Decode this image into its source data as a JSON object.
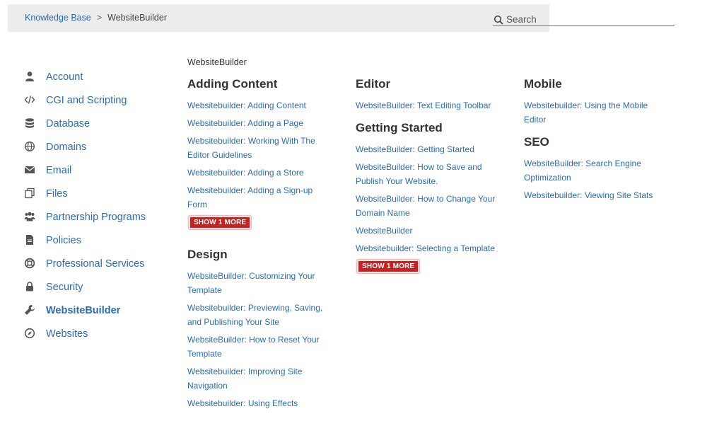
{
  "breadcrumb": {
    "root": "Knowledge Base",
    "separator": ">",
    "current": "WebsiteBuilder"
  },
  "search": {
    "placeholder": "Search",
    "value": ""
  },
  "page_label": "WebsiteBuilder",
  "sidebar": {
    "items": [
      {
        "label": "Account",
        "icon": "user-icon"
      },
      {
        "label": "CGI and Scripting",
        "icon": "code-icon"
      },
      {
        "label": "Database",
        "icon": "database-icon"
      },
      {
        "label": "Domains",
        "icon": "globe-icon"
      },
      {
        "label": "Email",
        "icon": "envelope-icon"
      },
      {
        "label": "Files",
        "icon": "files-icon"
      },
      {
        "label": "Partnership Programs",
        "icon": "users-icon"
      },
      {
        "label": "Policies",
        "icon": "document-icon"
      },
      {
        "label": "Professional Services",
        "icon": "lifebuoy-icon"
      },
      {
        "label": "Security",
        "icon": "lock-icon"
      },
      {
        "label": "WebsiteBuilder",
        "icon": "wrench-icon",
        "active": true
      },
      {
        "label": "Websites",
        "icon": "compass-icon"
      }
    ]
  },
  "columns": [
    [
      {
        "title": "Adding Content",
        "articles": [
          "Websitebuilder: Adding Content",
          "Websitebuilder: Adding a Page",
          "Websitebuilder: Working With The Editor Guidelines",
          "Websitebuilder: Adding a Store",
          "Websitebuilder: Adding a Sign-up Form"
        ],
        "show_more": "SHOW 1 MORE"
      },
      {
        "title": "Design",
        "articles": [
          "WebsiteBuilder: Customizing Your Template",
          "Websitebuilder: Previewing, Saving, and Publishing Your Site",
          "WebsiteBuilder: How to Reset Your Template",
          "Websitebuilder: Improving Site Navigation",
          "Websitebuilder: Using Effects"
        ],
        "show_more": ""
      }
    ],
    [
      {
        "title": "Editor",
        "articles": [
          "WebsiteBuilder: Text Editing Toolbar"
        ],
        "show_more": ""
      },
      {
        "title": "Getting Started",
        "articles": [
          "WebsiteBuilder: Getting Started",
          "WebsiteBuilder: How to Save and Publish Your Website.",
          "WebsiteBuilder: How to Change Your Domain Name",
          "WebsiteBuilder",
          "Websitebuilder: Selecting a Template"
        ],
        "show_more": "SHOW 1 MORE"
      }
    ],
    [
      {
        "title": "Mobile",
        "articles": [
          "Websitebuilder: Using the Mobile Editor"
        ],
        "show_more": ""
      },
      {
        "title": "SEO",
        "articles": [
          "WebsiteBuilder: Search Engine Optimization",
          "Websitebuilder: Viewing Site Stats"
        ],
        "show_more": ""
      }
    ]
  ],
  "colors": {
    "link": "#2b6cb0",
    "button": "#cc1f1f",
    "topbar": "#ececec"
  }
}
